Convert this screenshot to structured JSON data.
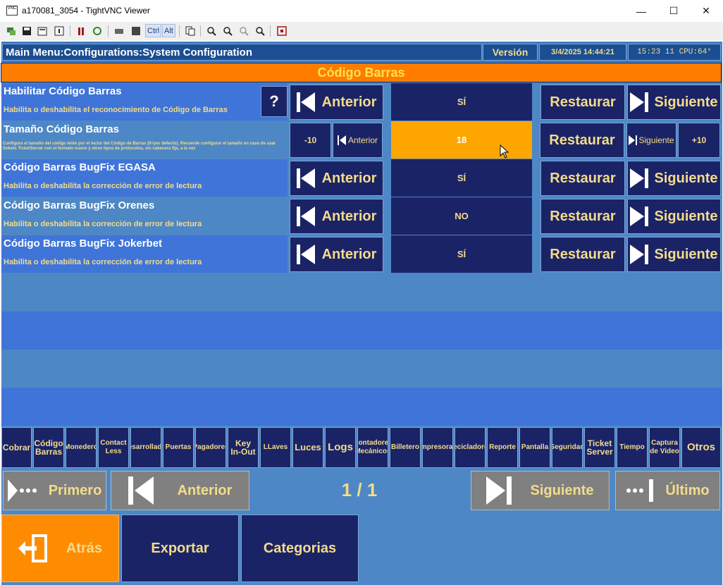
{
  "window": {
    "title": "a170081_3054 - TightVNC Viewer",
    "app_icon_text": "VNC",
    "minimize": "—",
    "maximize": "☐",
    "close": "✕"
  },
  "toolbar": {
    "ctrl_label": "Ctrl",
    "alt_label": "Alt"
  },
  "header": {
    "breadcrumb": "Main Menu:Configurations:System Configuration",
    "version_label": "Versión",
    "datetime": "3/4/2025 14:44:21",
    "status": "15:23 11 CPU:64°"
  },
  "section_title": "Código Barras",
  "rows": [
    {
      "name": "Habilitar Código Barras",
      "description": "Habilita o deshabilita el reconocimiento de Código de Barras",
      "value": "SÍ",
      "help": "?",
      "prev": "Anterior",
      "restore": "Restaurar",
      "next": "Siguiente"
    },
    {
      "name": "Tamaño Código Barras",
      "description": "Configura el tamaño del código leído por el lector del Código de Barras (0=por defecto). Recuerde configurar el tamaño en caso de usar Sokets TicketServer con el formato nuevo y otros tipos de protocolos, sin cabecera fija, a la vez",
      "value": "18",
      "minus": "-10",
      "prev": "Anterior",
      "restore": "Restaurar",
      "next": "Siguiente",
      "plus": "+10"
    },
    {
      "name": "Código Barras BugFix EGASA",
      "description": "Habilita o deshabilita la corrección de error de lectura",
      "value": "SÍ",
      "prev": "Anterior",
      "restore": "Restaurar",
      "next": "Siguiente"
    },
    {
      "name": "Código Barras BugFix Orenes",
      "description": "Habilita o deshabilita la corrección de error de lectura",
      "value": "NO",
      "prev": "Anterior",
      "restore": "Restaurar",
      "next": "Siguiente"
    },
    {
      "name": "Código Barras BugFix Jokerbet",
      "description": "Habilita o deshabilita la corrección de error de lectura",
      "value": "SÍ",
      "prev": "Anterior",
      "restore": "Restaurar",
      "next": "Siguiente"
    }
  ],
  "categories": [
    {
      "l1": "Cobrar",
      "l2": ""
    },
    {
      "l1": "Código",
      "l2": "Barras"
    },
    {
      "l1": "Monedero",
      "l2": ""
    },
    {
      "l1": "Contact",
      "l2": "Less"
    },
    {
      "l1": "Desarrollador",
      "l2": ""
    },
    {
      "l1": "Puertas",
      "l2": ""
    },
    {
      "l1": "Pagadores",
      "l2": ""
    },
    {
      "l1": "Key",
      "l2": "In-Out"
    },
    {
      "l1": "LLaves",
      "l2": ""
    },
    {
      "l1": "Luces",
      "l2": ""
    },
    {
      "l1": "Logs",
      "l2": ""
    },
    {
      "l1": "Contadores",
      "l2": "Mecánicos"
    },
    {
      "l1": "Billetero",
      "l2": ""
    },
    {
      "l1": "Impresoras",
      "l2": ""
    },
    {
      "l1": "Recicladores",
      "l2": ""
    },
    {
      "l1": "Reporte",
      "l2": ""
    },
    {
      "l1": "Pantalla",
      "l2": ""
    },
    {
      "l1": "Seguridad",
      "l2": ""
    },
    {
      "l1": "Ticket",
      "l2": "Server"
    },
    {
      "l1": "Tiempo",
      "l2": ""
    },
    {
      "l1": "Captura",
      "l2": "de Video"
    },
    {
      "l1": "Otros",
      "l2": ""
    }
  ],
  "pagination": {
    "first": "Primero",
    "prev": "Anterior",
    "page": "1 / 1",
    "next": "Siguiente",
    "last": "Último"
  },
  "bottom": {
    "back": "Atrás",
    "export": "Exportar",
    "categories": "Categorias"
  },
  "colors": {
    "background": "#4e87c5",
    "dark_button": "#1b2367",
    "label_text": "#f3dc8a",
    "section_bar": "#ff7c00",
    "selected_value": "#ffa500",
    "back_button": "#ff8c00"
  }
}
